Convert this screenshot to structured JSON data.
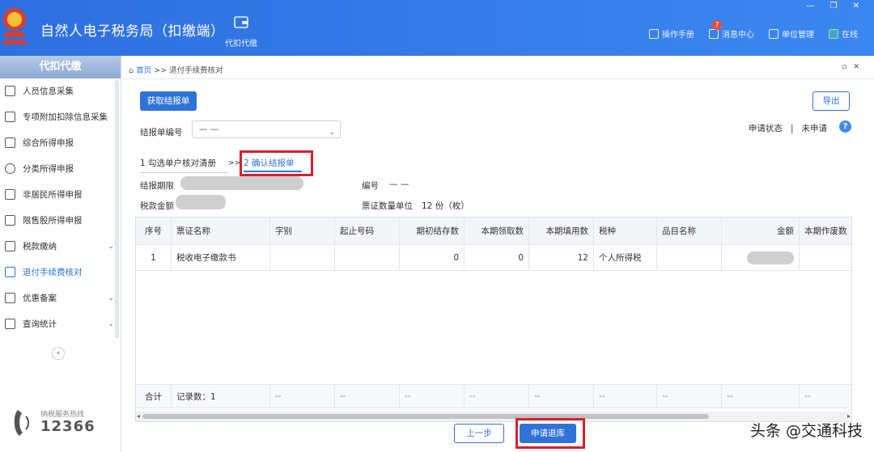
{
  "header": {
    "title": "自然人电子税务局（扣缴端）",
    "nav_daikou": "代扣代缴",
    "window_controls": "— ❐ ✕",
    "right_items": {
      "manual": "操作手册",
      "messages": "消息中心",
      "messages_badge": "7",
      "unit_mgmt": "单位管理",
      "online": "在线"
    }
  },
  "sidebar": {
    "heading": "代扣代缴",
    "items": [
      {
        "label": "人员信息采集",
        "icon": "person-icon"
      },
      {
        "label": "专项附加扣除信息采集",
        "icon": "list-icon"
      },
      {
        "label": "综合所得申报",
        "icon": "layers-icon"
      },
      {
        "label": "分类所得申报",
        "icon": "pie-icon"
      },
      {
        "label": "非居民所得申报",
        "icon": "user-icon"
      },
      {
        "label": "限售股所得申报",
        "icon": "bar-chart-icon"
      },
      {
        "label": "税款缴纳",
        "icon": "wallet-icon",
        "has_submenu": true
      },
      {
        "label": "退付手续费核对",
        "icon": "document-icon",
        "active": true
      },
      {
        "label": "优惠备案",
        "icon": "file-icon",
        "has_submenu": true
      },
      {
        "label": "查询统计",
        "icon": "search-list-icon",
        "has_submenu": true
      }
    ],
    "collapse": "«",
    "hotline_label": "纳税服务热线",
    "hotline_number": "12366"
  },
  "main": {
    "breadcrumb_home": "首页",
    "breadcrumb_sep": ">>",
    "breadcrumb_page": "退付手续费核对",
    "get_report_button": "获取结报单",
    "export_button": "导出",
    "report_no_label": "结报单编号",
    "report_no_value": "— —",
    "status_label": "申请状态",
    "status_sep": "|",
    "status_value": "未申请",
    "help": "?",
    "step1": "1 勾选单户核对清册",
    "step_arrow": ">>",
    "step2": "2 确认结报单",
    "period_label": "结报期限",
    "number_label": "编号",
    "number_value": "— —",
    "amount_label": "税款金额",
    "ticket_count_label": "票证数量单位",
    "ticket_count_value": "12 份（枚）",
    "table": {
      "columns": [
        "序号",
        "票证名称",
        "字别",
        "起止号码",
        "期初结存数",
        "本期领取数",
        "本期填用数",
        "税种",
        "品目名称",
        "金额",
        "本期作废数"
      ],
      "rows": [
        [
          "1",
          "税收电子缴款书",
          "",
          "",
          "0",
          "0",
          "12",
          "个人所得税",
          "",
          "",
          ""
        ]
      ],
      "footer": [
        "合计",
        "记录数：1",
        "--",
        "--",
        "--",
        "--",
        "--",
        "--",
        "--",
        "--",
        "--"
      ]
    },
    "prev_button": "上一步",
    "apply_button": "申请退库"
  },
  "watermark": "头条 @交通科技",
  "colors": {
    "primary": "#2f73d8",
    "highlight_red": "#d4202f",
    "header_blue": "#3b87f0"
  }
}
